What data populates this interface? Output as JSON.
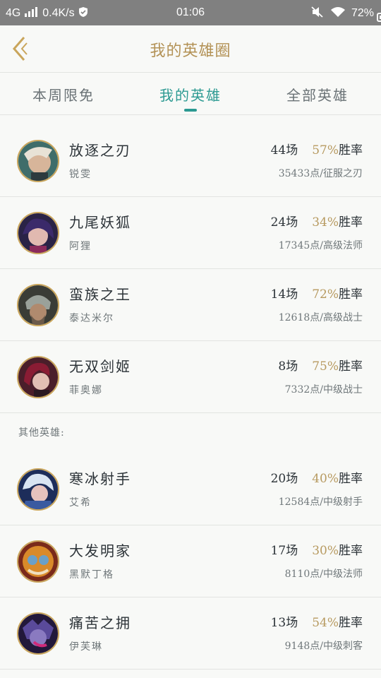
{
  "status_bar": {
    "network": "4G",
    "speed": "0.4K/s",
    "time": "01:06",
    "battery": "72%"
  },
  "header": {
    "title": "我的英雄圈"
  },
  "tabs": [
    {
      "label": "本周限免"
    },
    {
      "label": "我的英雄"
    },
    {
      "label": "全部英雄"
    }
  ],
  "rate_label": "胜率",
  "my_heroes": [
    {
      "name": "放逐之刃",
      "hero": "锐雯",
      "games": "44场",
      "rate": "57%",
      "points": "35433点/征服之刃"
    },
    {
      "name": "九尾妖狐",
      "hero": "阿狸",
      "games": "24场",
      "rate": "34%",
      "points": "17345点/高级法师"
    },
    {
      "name": "蛮族之王",
      "hero": "泰达米尔",
      "games": "14场",
      "rate": "72%",
      "points": "12618点/高级战士"
    },
    {
      "name": "无双剑姬",
      "hero": "菲奥娜",
      "games": "8场",
      "rate": "75%",
      "points": "7332点/中级战士"
    }
  ],
  "other_label": "其他英雄:",
  "other_heroes": [
    {
      "name": "寒冰射手",
      "hero": "艾希",
      "games": "20场",
      "rate": "40%",
      "points": "12584点/中级射手"
    },
    {
      "name": "大发明家",
      "hero": "黑默丁格",
      "games": "17场",
      "rate": "30%",
      "points": "8110点/中级法师"
    },
    {
      "name": "痛苦之拥",
      "hero": "伊芙琳",
      "games": "13场",
      "rate": "54%",
      "points": "9148点/中级刺客"
    }
  ],
  "colors": {
    "accent": "#2c9a92",
    "gold": "#b39256",
    "rate": "#b79a60",
    "status_bar": "#808080"
  },
  "icons": {
    "back": "chevron-left-icon",
    "signal": "signal-icon",
    "wifi": "wifi-icon",
    "mute": "mute-icon",
    "battery": "battery-icon"
  }
}
